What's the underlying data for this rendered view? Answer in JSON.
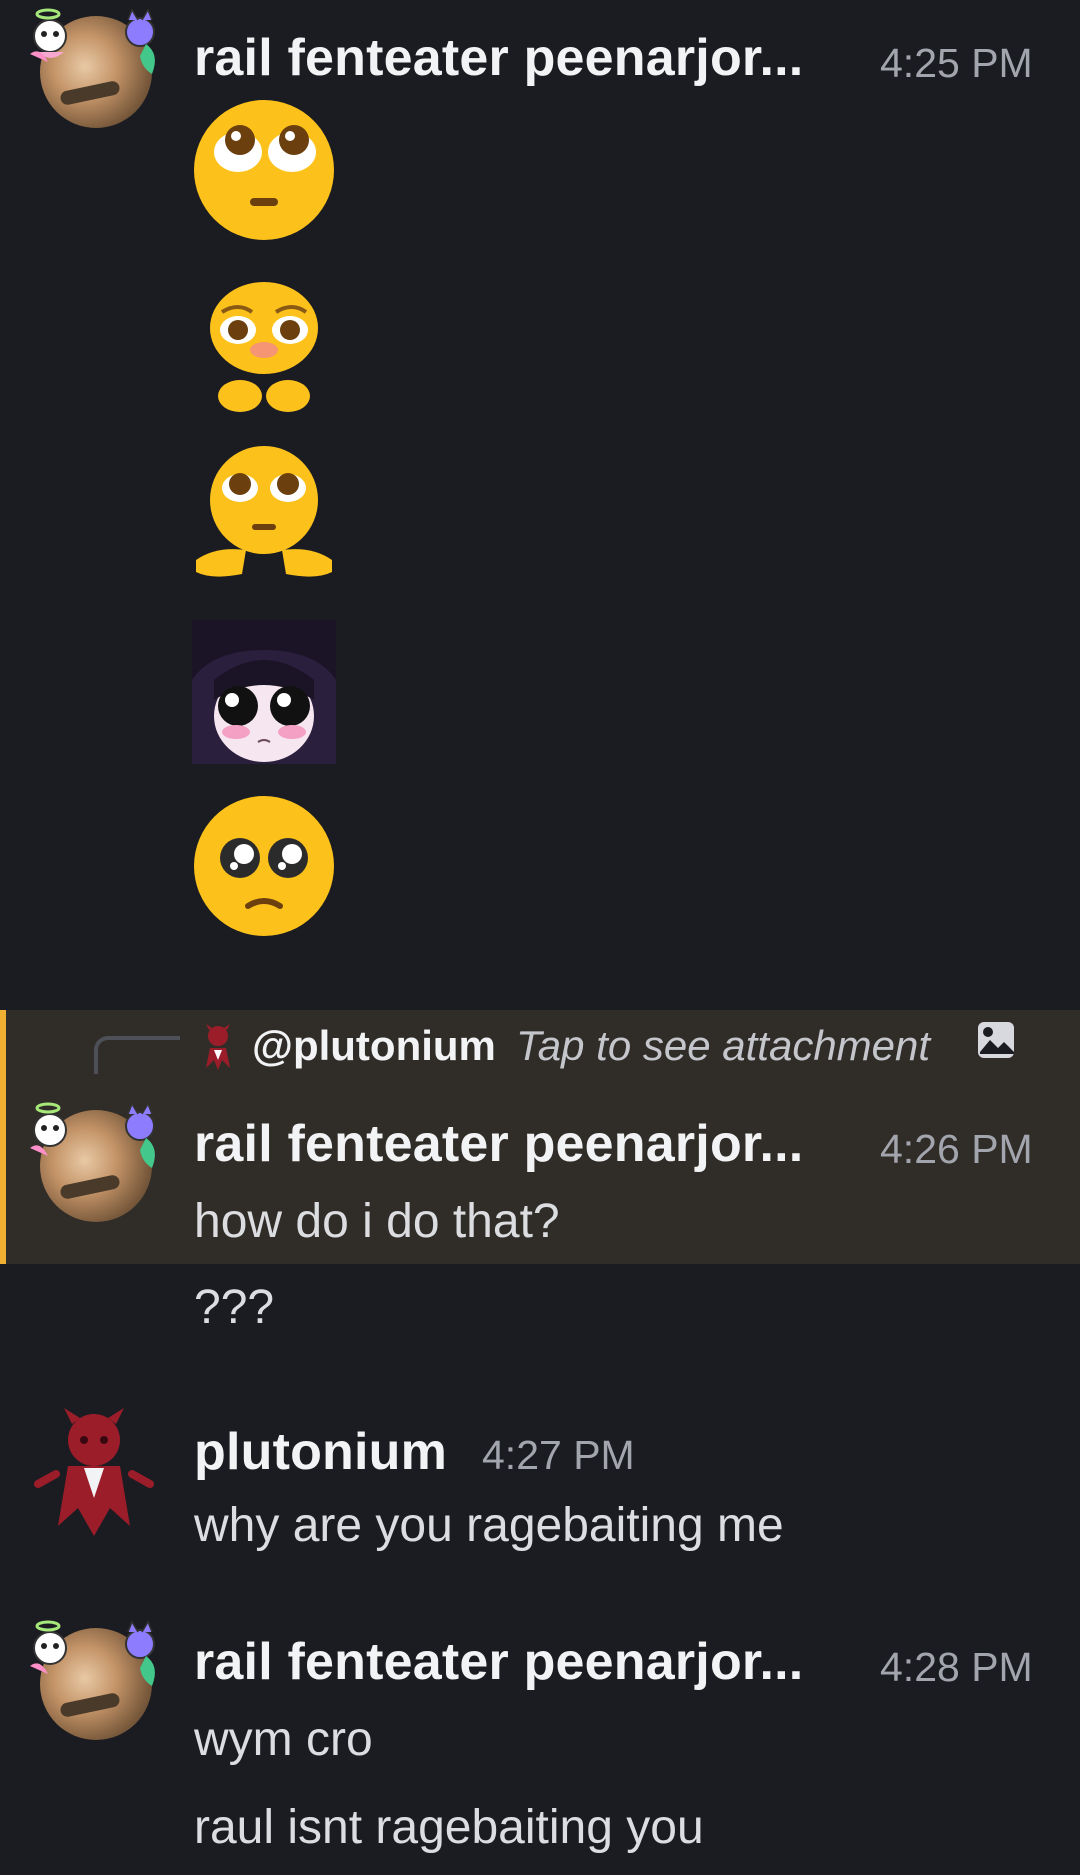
{
  "messages": [
    {
      "author": "rail fenteater peenarjor...",
      "time": "4:25 PM",
      "emojis": [
        "pleading-upward-face",
        "shy-blushing-face",
        "pointing-fingers-face",
        "anime-girl-big-eyes",
        "pleading-face"
      ]
    },
    {
      "reply": {
        "mention": "@plutonium",
        "preview": "Tap to see attachment",
        "icon": "image-icon"
      },
      "author": "rail fenteater peenarjor...",
      "time": "4:26 PM",
      "lines": [
        "how do i do that?",
        "???"
      ]
    },
    {
      "author": "plutonium",
      "time": "4:27 PM",
      "lines": [
        "why are you ragebaiting me"
      ]
    },
    {
      "author": "rail fenteater peenarjor...",
      "time": "4:28 PM",
      "lines": [
        "wym cro",
        "raul isnt ragebaiting you"
      ]
    }
  ],
  "colors": {
    "background": "#1b1c21",
    "reply_highlight": "#302d28",
    "reply_accent": "#f0b132",
    "timestamp": "#a2a5ad"
  }
}
